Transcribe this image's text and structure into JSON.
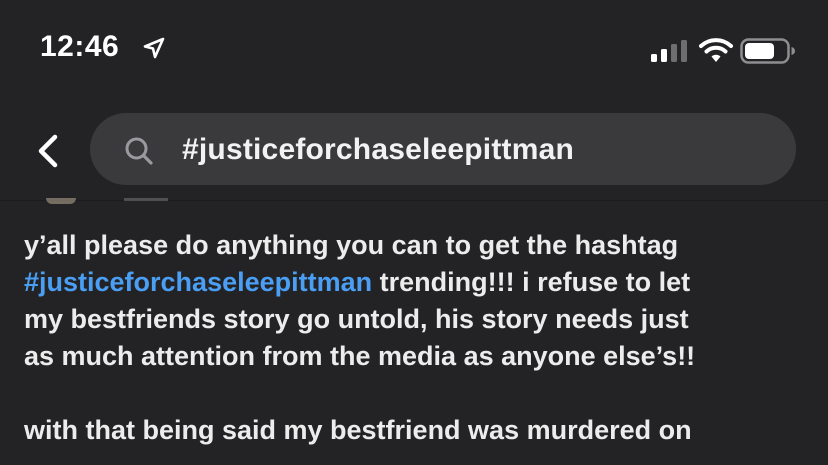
{
  "status_bar": {
    "time": "12:46",
    "icons": [
      "location-arrow-icon",
      "cellular-signal-icon",
      "wifi-icon",
      "battery-icon"
    ]
  },
  "nav": {
    "back_icon": "chevron-left-icon",
    "search": {
      "icon": "search-icon",
      "value": "#justiceforchaseleepittman"
    }
  },
  "post": {
    "line1": "y’all please do anything you can to get the hashtag",
    "line2_hashtag": "#justiceforchaseleepittman",
    "line2_rest": " trending!!! i refuse to let",
    "line3": "my bestfriends story go untold, his story needs just",
    "line4": "as much attention from the media as anyone else’s!!",
    "line5": "with that being said my bestfriend was murdered on"
  },
  "colors": {
    "background": "#232325",
    "search_field": "#3a3a3d",
    "text": "#ececed",
    "link": "#4a9ff5"
  }
}
